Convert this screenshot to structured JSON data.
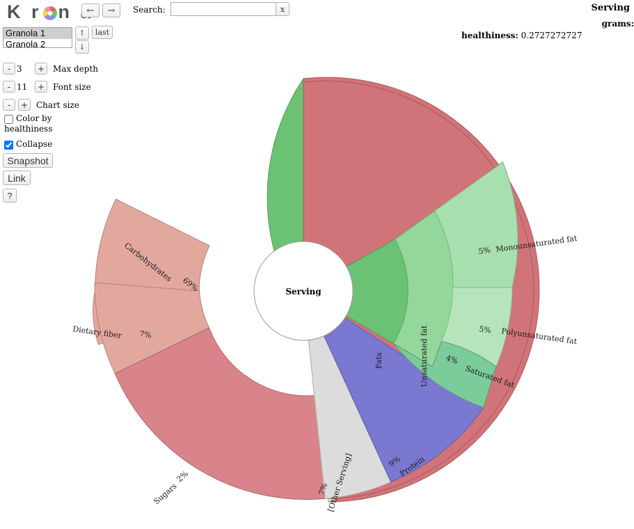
{
  "app": {
    "logo_text_left": "K r",
    "logo_text_right": "n a",
    "logo_icon": "krona-wheel-icon"
  },
  "toolbar": {
    "back_label": "←",
    "forward_label": "→",
    "search_label": "Search:",
    "search_value": "",
    "search_placeholder": "",
    "search_clear_label": "x"
  },
  "dataset": {
    "options": [
      "Granola 1",
      "Granola 2"
    ],
    "selected": "Granola 1",
    "up_label": "↑",
    "down_label": "↓",
    "last_label": "last"
  },
  "controls": {
    "minus_label": "-",
    "plus_label": "+",
    "max_depth_value": "3",
    "max_depth_label": "Max depth",
    "font_size_value": "11",
    "font_size_label": "Font size",
    "chart_size_label": "Chart size",
    "color_by_label": "Color by healthiness",
    "color_by_checked": false,
    "collapse_label": "Collapse",
    "collapse_checked": true,
    "snapshot_label": "Snapshot",
    "link_label": "Link",
    "help_label": "?"
  },
  "info": {
    "title": "Serving",
    "grams_key": "grams:",
    "grams_value": "",
    "healthiness_key": "healthiness:",
    "healthiness_value": "0.2727272727"
  },
  "chart_data": {
    "type": "pie",
    "title": "Serving",
    "center_label": "Serving",
    "colors": {
      "carbohydrates": "#d17479",
      "dietary_fiber": "#e2a89e",
      "sugars": "#d8848a",
      "other_serving": "#dcdcdc",
      "protein": "#7b78d1",
      "fats": "#6cc274",
      "unsaturated_fat": "#93d79b",
      "monounsaturated_fat": "#a8dfae",
      "polyunsaturated_fat": "#b6e4bb",
      "saturated_fat": "#7ccb9b"
    },
    "ring1": [
      {
        "name": "Carbohydrates",
        "percent": 69,
        "label": "Carbohydrates",
        "percent_label": "69%",
        "color": "#d17479"
      },
      {
        "name": "Other Serving",
        "percent": 7,
        "label": "[Other Serving]",
        "percent_label": "7%",
        "color": "#dcdcdc"
      },
      {
        "name": "Protein",
        "percent": 9,
        "label": "Protein",
        "percent_label": "9%",
        "color": "#7b78d1"
      },
      {
        "name": "Fats",
        "percent": 15,
        "label": "Fats",
        "percent_label": "",
        "color": "#6cc274"
      }
    ],
    "ring2": [
      {
        "name": "Dietary fiber",
        "parent": "Carbohydrates",
        "percent": 7,
        "label": "Dietary fiber",
        "percent_label": "7%",
        "color": "#e2a89e"
      },
      {
        "name": "Sugars",
        "parent": "Carbohydrates",
        "percent": 2,
        "label": "Sugars",
        "percent_label": "2%",
        "color": "#d8848a"
      },
      {
        "name": "Unsaturated fat",
        "parent": "Fats",
        "percent": 10,
        "label": "Unsaturated fat",
        "percent_label": "",
        "color": "#93d79b"
      },
      {
        "name": "Saturated fat",
        "parent": "Fats",
        "percent": 4,
        "label": "Saturated fat",
        "percent_label": "4%",
        "color": "#7ccb9b"
      }
    ],
    "ring3": [
      {
        "name": "Monounsaturated fat",
        "parent": "Unsaturated fat",
        "percent": 5,
        "label": "Monounsaturated fat",
        "percent_label": "5%",
        "color": "#a8dfae"
      },
      {
        "name": "Polyunsaturated fat",
        "parent": "Unsaturated fat",
        "percent": 5,
        "label": "Polyunsaturated fat",
        "percent_label": "5%",
        "color": "#b6e4bb"
      }
    ],
    "labels": {
      "carbohydrates": "Carbohydrates",
      "carbohydrates_pct": "69%",
      "dietary_fiber": "Dietary fiber",
      "dietary_fiber_pct": "7%",
      "sugars": "Sugars",
      "sugars_pct": "2%",
      "other_serving": "[Other Serving]",
      "other_serving_pct": "7%",
      "protein": "Protein",
      "protein_pct": "9%",
      "fats": "Fats",
      "unsaturated_fat": "Unsaturated fat",
      "monounsaturated_fat": "Monounsaturated fat",
      "monounsaturated_fat_pct": "5%",
      "polyunsaturated_fat": "Polyunsaturated fat",
      "polyunsaturated_fat_pct": "5%",
      "saturated_fat": "Saturated fat",
      "saturated_fat_pct": "4%"
    }
  }
}
